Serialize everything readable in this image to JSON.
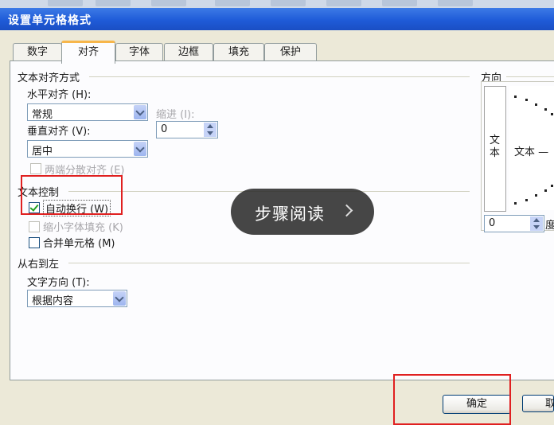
{
  "dialog": {
    "title": "设置单元格格式"
  },
  "tabs": [
    {
      "label": "数字",
      "active": false
    },
    {
      "label": "对齐",
      "active": true
    },
    {
      "label": "字体",
      "active": false
    },
    {
      "label": "边框",
      "active": false
    },
    {
      "label": "填充",
      "active": false
    },
    {
      "label": "保护",
      "active": false
    }
  ],
  "alignment": {
    "section_title": "文本对齐方式",
    "horizontal_label": "水平对齐 (H):",
    "horizontal_value": "常规",
    "indent_label": "缩进 (I):",
    "indent_value": "0",
    "vertical_label": "垂直对齐 (V):",
    "vertical_value": "居中",
    "justify_distributed_label": "两端分散对齐 (E)"
  },
  "text_control": {
    "section_title": "文本控制",
    "wrap_text_label": "自动换行 (W)",
    "wrap_text_checked": true,
    "shrink_to_fit_label": "缩小字体填充 (K)",
    "merge_cells_label": "合并单元格 (M)",
    "merge_cells_checked": false
  },
  "rtl": {
    "section_title": "从右到左",
    "direction_label": "文字方向 (T):",
    "direction_value": "根据内容"
  },
  "orientation": {
    "section_title": "方向",
    "vertical_text": "文本",
    "dial_text": "文本 —",
    "degrees_value": "0",
    "degrees_unit": "度"
  },
  "overlay": {
    "label": "步骤阅读"
  },
  "buttons": {
    "ok_label": "确定",
    "cancel_label": "取"
  },
  "colors": {
    "title_bar": "#1f5bd8",
    "highlight_box": "#e02020",
    "tab_accent": "#f7b64b"
  }
}
